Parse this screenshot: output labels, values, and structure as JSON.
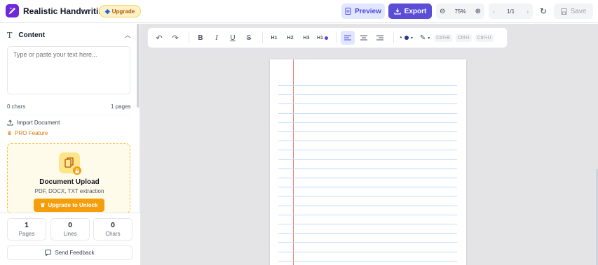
{
  "header": {
    "app_title": "Realistic Handwriting",
    "upgrade_label": "Upgrade",
    "preview_label": "Preview",
    "export_label": "Export",
    "zoom_level": "75%",
    "page_indicator": "1/1",
    "save_label": "Save"
  },
  "sidebar": {
    "content_title": "Content",
    "textarea_placeholder": "Type or paste your text here...",
    "chars_count": "0 chars",
    "pages_count": "1 pages",
    "import_label": "Import Document",
    "pro_label": "PRO Feature",
    "upload": {
      "title": "Document Upload",
      "subtitle": "PDF, DOCX, TXT extraction",
      "button_label": "Upgrade to Unlock"
    },
    "stats": [
      {
        "value": "1",
        "label": "Pages"
      },
      {
        "value": "0",
        "label": "Lines"
      },
      {
        "value": "0",
        "label": "Chars"
      }
    ],
    "feedback_label": "Send Feedback"
  },
  "toolbar": {
    "h1": "H1",
    "h2": "H2",
    "h3": "H3",
    "h1_dot": "H1",
    "shortcut_bold": "Ctrl+B",
    "shortcut_italic": "Ctrl+I",
    "shortcut_underline": "Ctrl+U",
    "ink_color": "#1e3a8a"
  },
  "colors": {
    "accent": "#5b4dd6",
    "pro": "#f59e0b",
    "margin_line": "#f87171",
    "rule_line": "#bfdbfe"
  }
}
